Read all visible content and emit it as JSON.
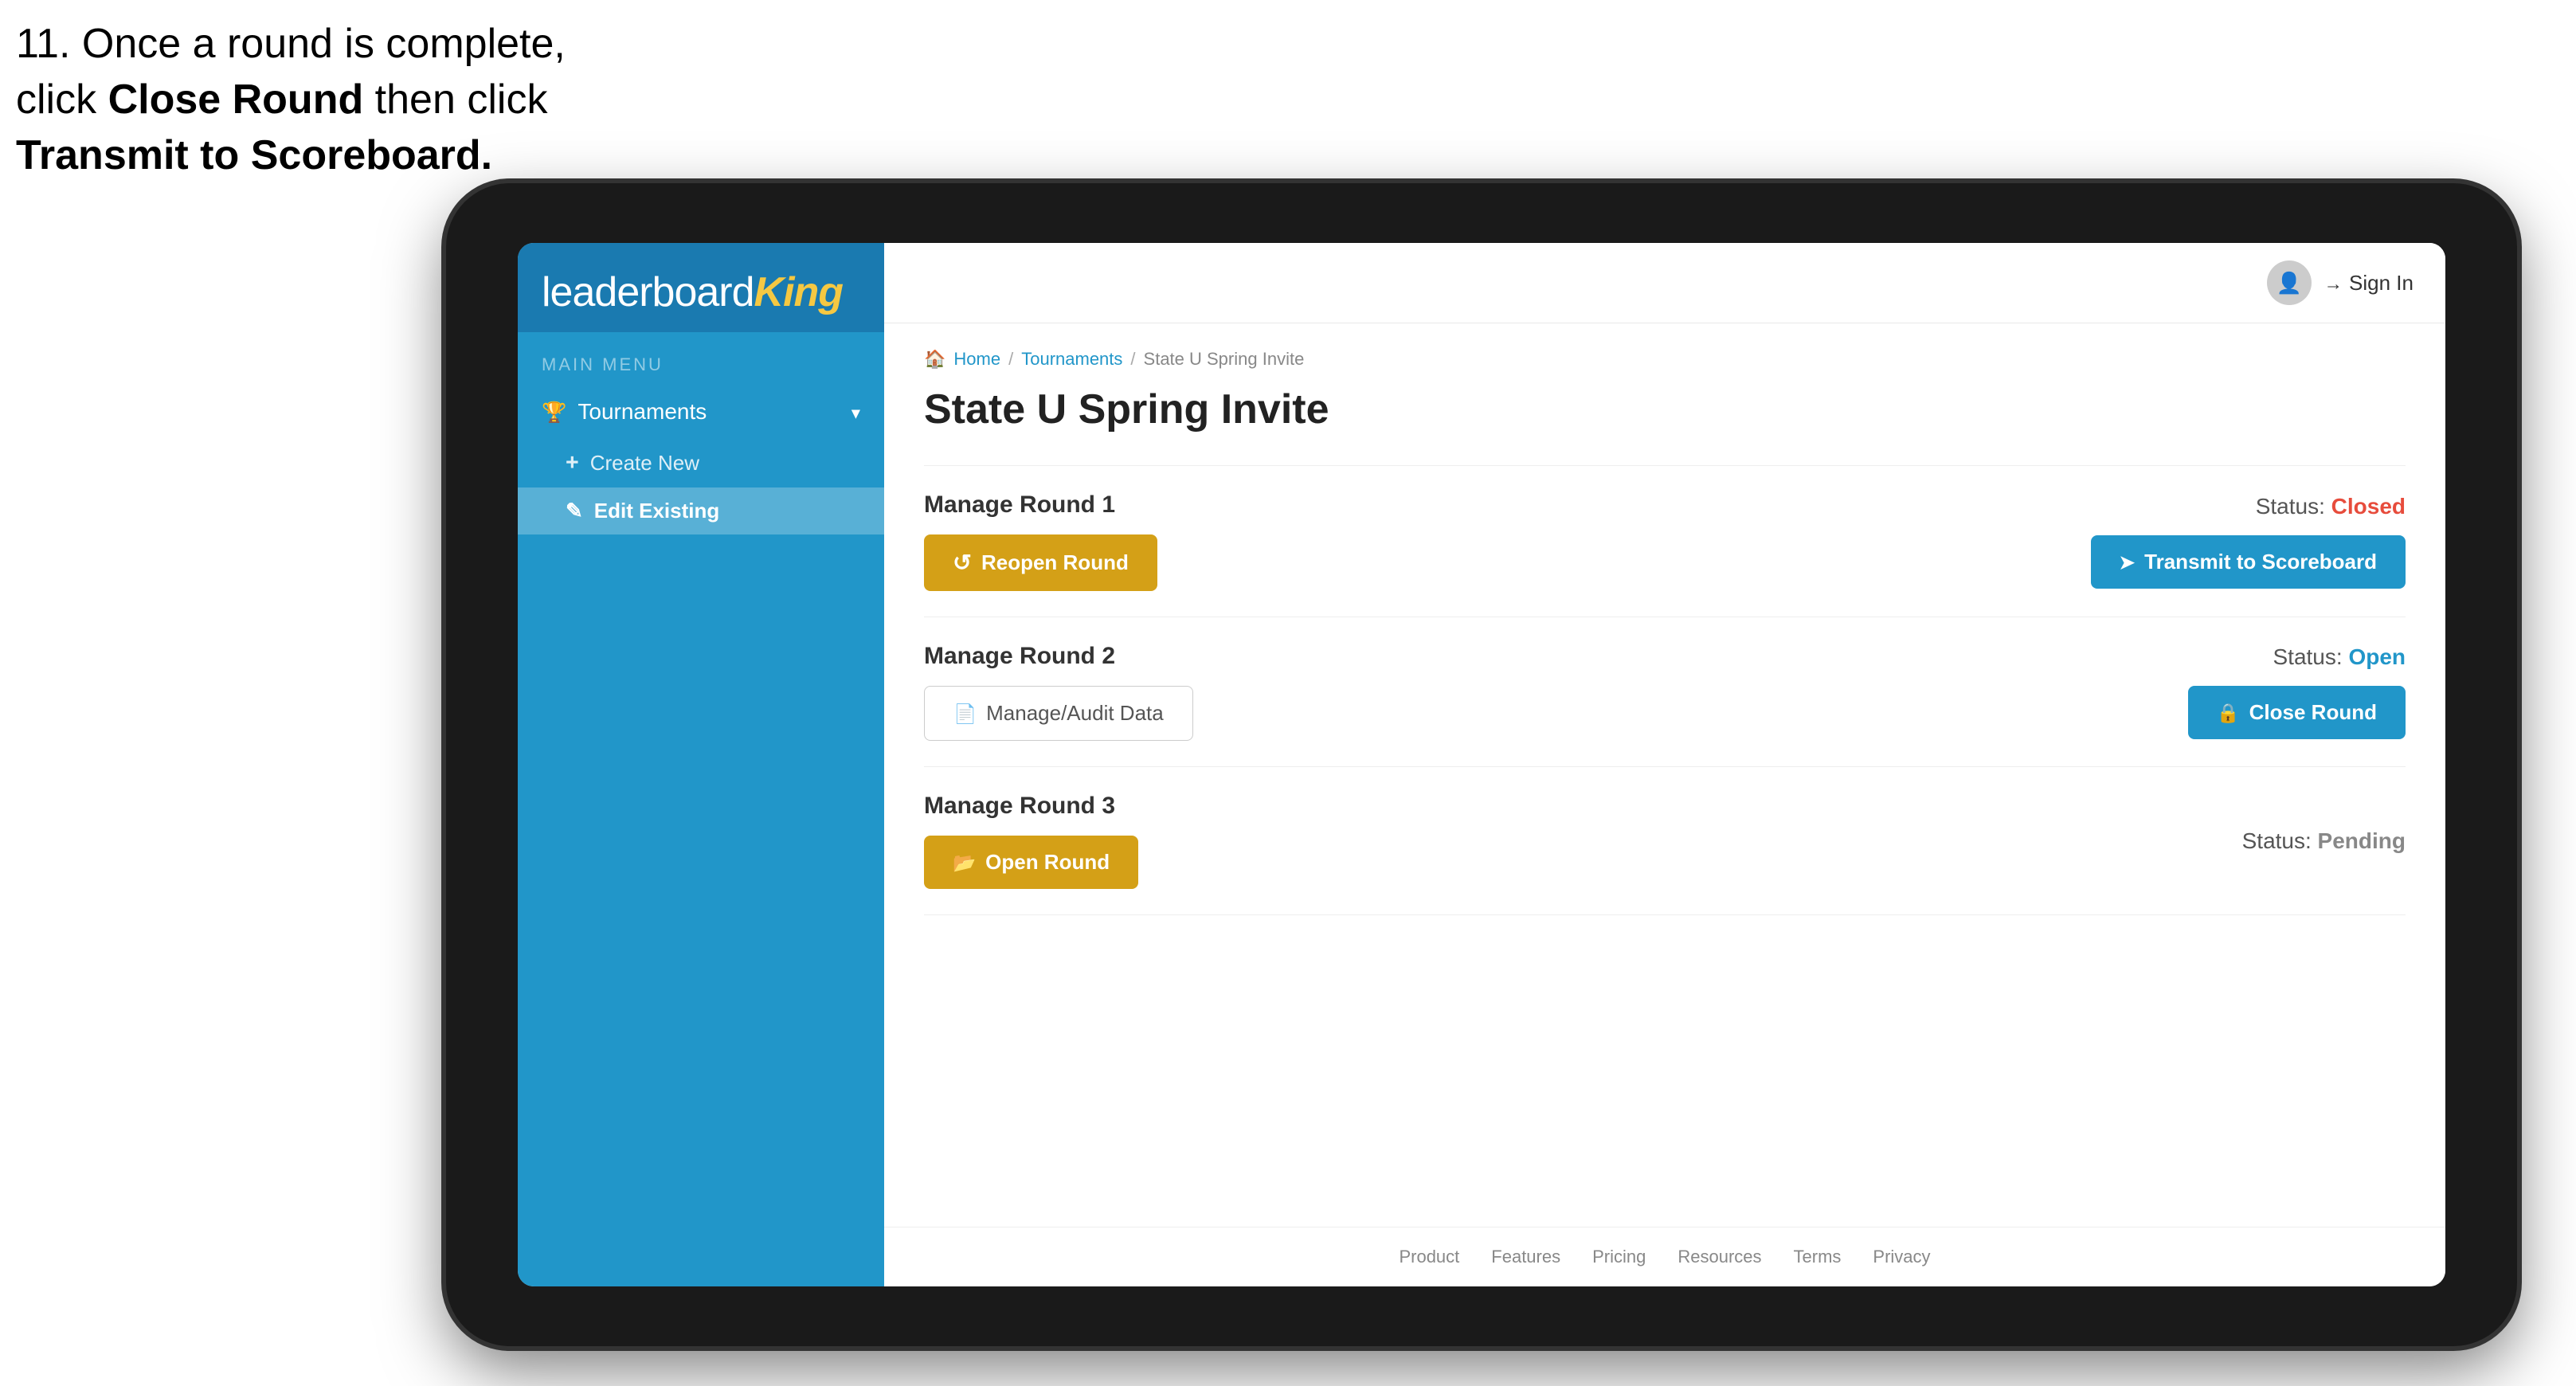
{
  "instruction": {
    "line1": "11. Once a round is complete,",
    "line2": "click ",
    "bold1": "Close Round",
    "line3": " then click",
    "bold2": "Transmit to Scoreboard."
  },
  "sidebar": {
    "logo": {
      "leaderboard": "leaderboard",
      "king": "King"
    },
    "main_menu_label": "MAIN MENU",
    "tournaments_label": "Tournaments",
    "create_new_label": "Create New",
    "edit_existing_label": "Edit Existing"
  },
  "header": {
    "sign_in_label": "Sign In"
  },
  "breadcrumb": {
    "home": "Home",
    "tournaments": "Tournaments",
    "current": "State U Spring Invite"
  },
  "page": {
    "title": "State U Spring Invite",
    "rounds": [
      {
        "label": "Manage Round 1",
        "status_label": "Status:",
        "status_value": "Closed",
        "status_type": "closed",
        "primary_button": "Reopen Round",
        "secondary_button": "Transmit to Scoreboard"
      },
      {
        "label": "Manage Round 2",
        "status_label": "Status:",
        "status_value": "Open",
        "status_type": "open",
        "primary_button": "Manage/Audit Data",
        "secondary_button": "Close Round"
      },
      {
        "label": "Manage Round 3",
        "status_label": "Status:",
        "status_value": "Pending",
        "status_type": "pending",
        "primary_button": "Open Round",
        "secondary_button": null
      }
    ]
  },
  "footer": {
    "links": [
      "Product",
      "Features",
      "Pricing",
      "Resources",
      "Terms",
      "Privacy"
    ]
  }
}
